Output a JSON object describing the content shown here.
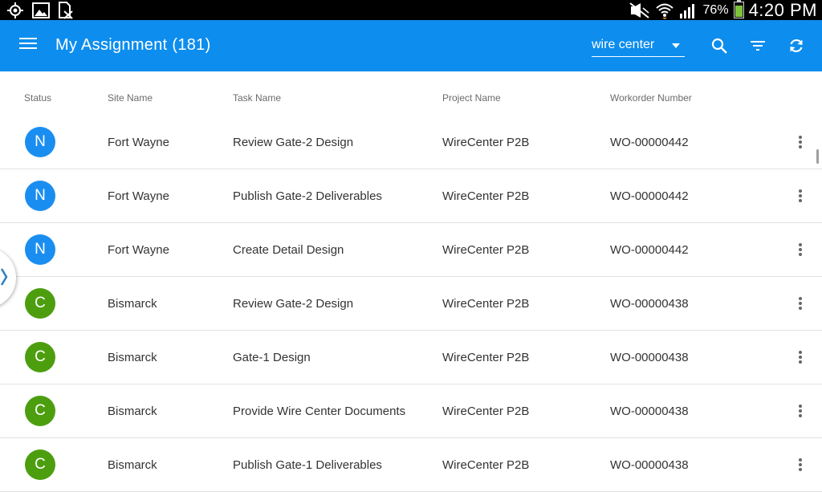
{
  "status_bar": {
    "battery_percent": "76%",
    "battery_level": 0.76,
    "time": "4:20 PM",
    "icons": [
      "location-icon",
      "gallery-icon",
      "sim-off-icon",
      "mute-icon",
      "wifi-icon",
      "signal-icon",
      "battery-icon"
    ]
  },
  "appbar": {
    "title": "My Assignment (181)",
    "filter_value": "wire center",
    "icons": [
      "menu-icon",
      "search-icon",
      "filter-icon",
      "refresh-icon"
    ],
    "color": "#0d8ded"
  },
  "table": {
    "headers": {
      "status": "Status",
      "site": "Site Name",
      "task": "Task Name",
      "project": "Project Name",
      "workorder": "Workorder Number"
    },
    "rows": [
      {
        "status": "N",
        "status_color": "#1a8ef0",
        "site": "Fort Wayne",
        "task": "Review Gate-2 Design",
        "project": "WireCenter P2B",
        "workorder": "WO-00000442"
      },
      {
        "status": "N",
        "status_color": "#1a8ef0",
        "site": "Fort Wayne",
        "task": "Publish Gate-2 Deliverables",
        "project": "WireCenter P2B",
        "workorder": "WO-00000442"
      },
      {
        "status": "N",
        "status_color": "#1a8ef0",
        "site": "Fort Wayne",
        "task": "Create Detail Design",
        "project": "WireCenter P2B",
        "workorder": "WO-00000442"
      },
      {
        "status": "C",
        "status_color": "#4c9e0f",
        "site": "Bismarck",
        "task": "Review Gate-2 Design",
        "project": "WireCenter P2B",
        "workorder": "WO-00000438"
      },
      {
        "status": "C",
        "status_color": "#4c9e0f",
        "site": "Bismarck",
        "task": "Gate-1 Design",
        "project": "WireCenter P2B",
        "workorder": "WO-00000438"
      },
      {
        "status": "C",
        "status_color": "#4c9e0f",
        "site": "Bismarck",
        "task": "Provide Wire Center Documents",
        "project": "WireCenter P2B",
        "workorder": "WO-00000438"
      },
      {
        "status": "C",
        "status_color": "#4c9e0f",
        "site": "Bismarck",
        "task": "Publish Gate-1 Deliverables",
        "project": "WireCenter P2B",
        "workorder": "WO-00000438"
      }
    ]
  }
}
